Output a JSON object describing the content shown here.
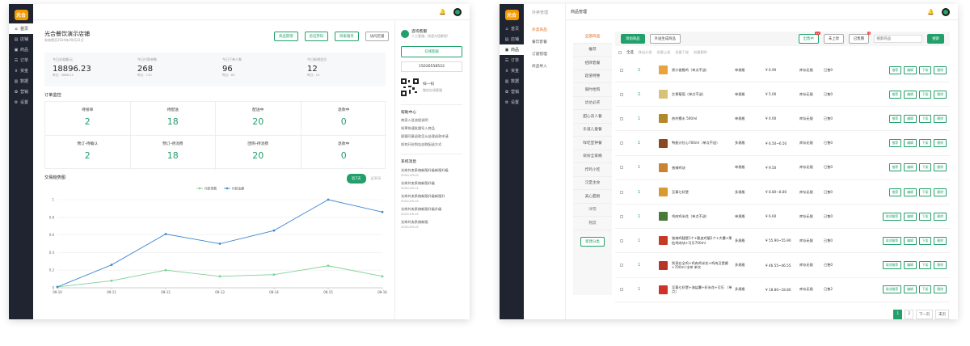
{
  "colors": {
    "accent": "#22a06b",
    "chart_blue": "#3f88d0",
    "chart_green": "#7dd195",
    "sidebar": "#1f2430",
    "logo": "#f39a00",
    "active_orange": "#e26b1c"
  },
  "app": {
    "logo": "光合"
  },
  "w1": {
    "nav": [
      {
        "label": "首页",
        "icon": "home-icon"
      },
      {
        "label": "店铺",
        "icon": "store-icon"
      },
      {
        "label": "商品",
        "icon": "goods-icon"
      },
      {
        "label": "订单",
        "icon": "order-icon"
      },
      {
        "label": "资金",
        "icon": "money-icon"
      },
      {
        "label": "数据",
        "icon": "data-icon"
      },
      {
        "label": "营销",
        "icon": "gift-icon"
      },
      {
        "label": "设置",
        "icon": "gear-icon"
      }
    ],
    "store_name": "光合餐饮演示店铺",
    "store_expiry": "有效期至2024年09月22日",
    "top_buttons": [
      "商品管理",
      "验证券码",
      "商家服务",
      "访问店铺"
    ],
    "stats": [
      {
        "label": "今日交易额/元",
        "value": "18896.23",
        "prev": "昨日：9868.23"
      },
      {
        "label": "今日付款单数",
        "value": "268",
        "prev": "昨日：110"
      },
      {
        "label": "今日下单人数",
        "value": "96",
        "prev": "昨日：89"
      },
      {
        "label": "今日新增会员",
        "value": "12",
        "prev": "昨日：10"
      }
    ],
    "monitor_title": "订单监控",
    "monitor_row1": [
      {
        "label": "待接单",
        "value": "2"
      },
      {
        "label": "待配送",
        "value": "18"
      },
      {
        "label": "配送中",
        "value": "20"
      },
      {
        "label": "退款中",
        "value": "0"
      }
    ],
    "monitor_row2": [
      {
        "label": "预订-待确认",
        "value": "2"
      },
      {
        "label": "预订-待消费",
        "value": "18"
      },
      {
        "label": "团购-待消费",
        "value": "20"
      },
      {
        "label": "退款中",
        "value": "0"
      }
    ],
    "trend_title": "交易趋势图",
    "trend_tabs": [
      "近7天",
      "近30天"
    ],
    "service": {
      "title": "咨询客服",
      "subtitle": "人工客服，快速为您解答!",
      "online_label": "在线客服",
      "phone": "15026558522",
      "scan_title": "扫一扫",
      "scan_sub": "微信在线客服"
    },
    "help": {
      "title": "帮助中心",
      "items": [
        "商家入驻流程说明",
        "如果快速批量导入商品",
        "顾客同意退款怎么处理退款申请",
        "如何开启到店自取配送方式"
      ]
    },
    "sys": {
      "title": "系统消息",
      "items": [
        {
          "title": "光命外卖系统新版升级新版升级",
          "date": "2020-09-01"
        },
        {
          "title": "光命外卖系统新版升级",
          "date": "2020-09-01"
        },
        {
          "title": "光命外卖系统新版升级新版升",
          "date": "2020-09-01"
        },
        {
          "title": "光命外卖系统新版升级升级",
          "date": "2020-09-01"
        },
        {
          "title": "光命外卖系统新版",
          "date": "2020-09-01"
        }
      ]
    }
  },
  "chart_data": {
    "type": "line",
    "title": "交易趋势图",
    "x": [
      "09-10",
      "09-11",
      "09-12",
      "09-13",
      "09-14",
      "09-15",
      "09-16"
    ],
    "ylim": [
      0,
      1
    ],
    "yticks": [
      "1",
      "0.8",
      "0.6",
      "0.4",
      "0.2",
      "0"
    ],
    "series": [
      {
        "name": "付款单数",
        "color": "#7dd195",
        "values": [
          0.01,
          0.08,
          0.2,
          0.13,
          0.15,
          0.25,
          0.13
        ]
      },
      {
        "name": "付款金额",
        "color": "#3f88d0",
        "values": [
          0.01,
          0.26,
          0.61,
          0.5,
          0.65,
          1.0,
          0.86
        ]
      }
    ],
    "legend": "top",
    "grid": true
  },
  "w2": {
    "nav": [
      {
        "label": "首页",
        "icon": "home-icon"
      },
      {
        "label": "店铺",
        "icon": "store-icon"
      },
      {
        "label": "商品",
        "icon": "goods-icon"
      },
      {
        "label": "订单",
        "icon": "order-icon"
      },
      {
        "label": "资金",
        "icon": "money-icon"
      },
      {
        "label": "数据",
        "icon": "data-icon"
      },
      {
        "label": "营销",
        "icon": "gift-icon"
      },
      {
        "label": "设置",
        "icon": "gear-icon"
      }
    ],
    "breadcrumb_parent": "外卖管理",
    "breadcrumb_current": "商品管理",
    "submenu": [
      "外卖商品",
      "餐饮套餐",
      "订座管理",
      "商品导入"
    ],
    "categories": [
      "全部商品",
      "推荐",
      "招牌套餐",
      "超值特惠",
      "限时抢购",
      "达达必买",
      "甜心双人餐",
      "乐道儿童餐",
      "咩吃堡钟餐",
      "缤纷全家桶",
      "炸鸡小吃",
      "汉堡主食",
      "美心甜厨",
      "冷饮",
      "热饮"
    ],
    "new_cat_btn": "新建分类",
    "toolbar": {
      "add": "添加商品",
      "batch": "外送生成商品",
      "sale": "出售中",
      "sale_badge": "22",
      "off": "未上架",
      "sold": "已售罄",
      "sold_badge": "3",
      "search_placeholder": "搜索商品",
      "search_btn": "搜索"
    },
    "batch": {
      "all": "全选",
      "actions": [
        "移出分类",
        "批量上架",
        "批量下架",
        "批量删除"
      ]
    },
    "rows": [
      {
        "rank": "2",
        "name": "原汁香脆鸡（单点不送）",
        "spec": "单规格",
        "price": "¥ 6.90",
        "stock": "库存无限",
        "sold": "已售0",
        "acts": [
          "推荐",
          "编辑",
          "下架",
          "删除"
        ],
        "thumb": "#e7a43a"
      },
      {
        "rank": "2",
        "name": "芒果葡萄（单点不送）",
        "spec": "单规格",
        "price": "¥ 5.00",
        "stock": "库存无限",
        "sold": "已售0",
        "acts": [
          "推荐",
          "编辑",
          "下架",
          "删除"
        ],
        "thumb": "#d7c27a"
      },
      {
        "rank": "1",
        "name": "热柠檬水 500ml",
        "spec": "单规格",
        "price": "¥ 4.00",
        "stock": "库存无限",
        "sold": "已售0",
        "acts": [
          "推荐",
          "编辑",
          "下架",
          "删除"
        ],
        "thumb": "#b3872c"
      },
      {
        "rank": "1",
        "name": "鸭翅沙拉心700ml（单点不送）",
        "spec": "多规格",
        "price": "¥ 6.50~6.50",
        "stock": "库存无限",
        "sold": "已售0",
        "acts": [
          "推荐",
          "编辑",
          "下架",
          "删除"
        ],
        "thumb": "#8a4a1f"
      },
      {
        "rank": "1",
        "name": "香辣鸡块",
        "spec": "单规格",
        "price": "¥ 9.50",
        "stock": "库存无限",
        "sold": "已售0",
        "acts": [
          "推荐",
          "编辑",
          "下架",
          "删除"
        ],
        "thumb": "#c8842f"
      },
      {
        "rank": "1",
        "name": "至尊七虾堡",
        "spec": "多规格",
        "price": "¥ 8.80~8.80",
        "stock": "库存无限",
        "sold": "已售0",
        "acts": [
          "推荐",
          "编辑",
          "下架",
          "删除"
        ],
        "thumb": "#d89a2e"
      },
      {
        "rank": "1",
        "name": "鸡肉鸡米花（单点不送）",
        "spec": "单规格",
        "price": "¥ 6.60",
        "stock": "库存无限",
        "sold": "已售0",
        "acts": [
          "取消推荐",
          "编辑",
          "下架",
          "删除"
        ],
        "thumb": "#4a7a3a"
      },
      {
        "rank": "1",
        "name": "香辣鸡腿堡1个+脆皮鸡腿1个+大薯+果粒鸡肉块+可乐700ml",
        "spec": "多规格",
        "price": "¥ 55.90~55.90",
        "stock": "库存无限",
        "sold": "已售0",
        "acts": [
          "取消推荐",
          "编辑",
          "下架",
          "删除"
        ],
        "thumb": "#c43a25"
      },
      {
        "rank": "1",
        "name": "到现在全鸡+鸡肉鸡米花+鸡肉汉堡酱+700ml 冰茶 单次",
        "spec": "多规格",
        "price": "¥ 46.55~46.55",
        "stock": "库存无限",
        "sold": "已售0",
        "acts": [
          "取消推荐",
          "编辑",
          "下架",
          "删除"
        ],
        "thumb": "#b8352a"
      },
      {
        "rank": "1",
        "name": "至尊七虾堡+海盐薯+虾米花+可乐 （单点）",
        "spec": "多规格",
        "price": "¥ 18.80~18.80",
        "stock": "库存无限",
        "sold": "已售2",
        "acts": [
          "取消推荐",
          "编辑",
          "下架",
          "删除"
        ],
        "thumb": "#d0322a"
      }
    ],
    "pagination": [
      "1",
      "2",
      "下一页",
      "末页"
    ]
  }
}
